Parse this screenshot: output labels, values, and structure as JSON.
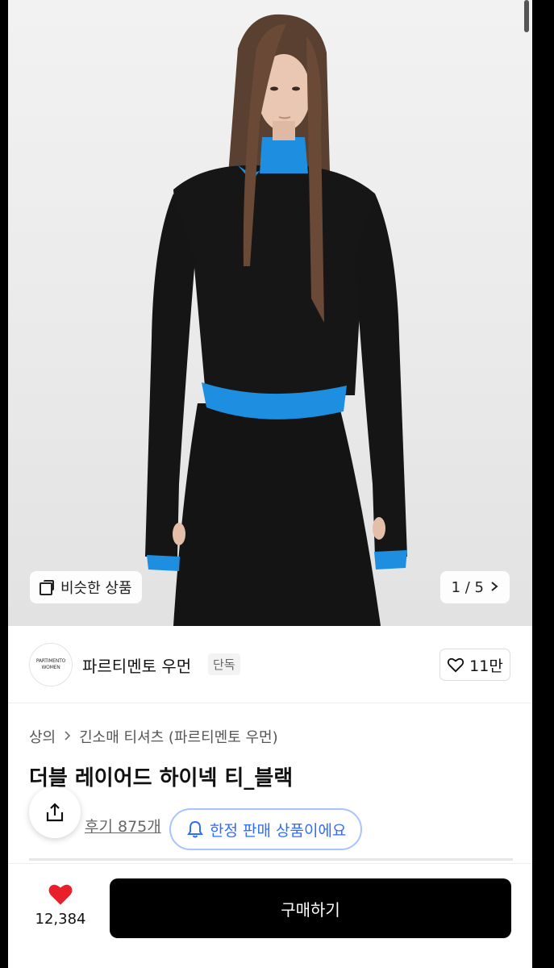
{
  "hero": {
    "similar_label": "비슷한 상품",
    "page_counter": "1 / 5"
  },
  "brand": {
    "logo_line1": "PARTIMENTO",
    "logo_line2": "WOMEN",
    "name": "파르티멘토 우먼",
    "badge": "단독",
    "like_count": "11만"
  },
  "product": {
    "breadcrumb": [
      "상의",
      "긴소매 티셔츠 (파르티멘토 우먼)"
    ],
    "title": "더블 레이어드 하이넥 티_블랙",
    "reviews_link": "후기 875개",
    "limited_label": "한정 판매 상품이에요"
  },
  "bottom": {
    "wish_count": "12,384",
    "buy_label": "구매하기"
  },
  "colors": {
    "accent_blue": "#2f6bff",
    "heart_red": "#e8202a",
    "buy_button": "#000000"
  }
}
